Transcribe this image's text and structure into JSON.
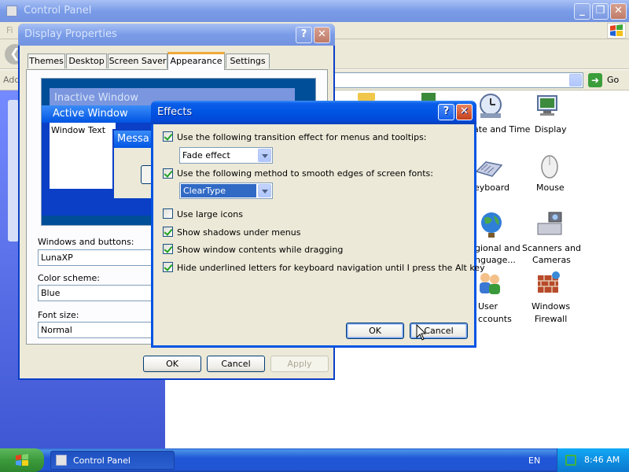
{
  "control_panel": {
    "title": "Control Panel",
    "menu_letter": "Fi",
    "address_label": "Add",
    "go_label": "Go",
    "icons": [
      {
        "label": "ate and Time",
        "icon": "clock-icon"
      },
      {
        "label": "Display",
        "icon": "display-icon"
      },
      {
        "label": "eyboard",
        "icon": "keyboard-icon"
      },
      {
        "label": "Mouse",
        "icon": "mouse-icon"
      },
      {
        "label": "gional and\nnguage...",
        "icon": "globe-icon"
      },
      {
        "label": "Scanners and\nCameras",
        "icon": "scanner-icon"
      },
      {
        "label": "User\nccounts",
        "icon": "users-icon"
      },
      {
        "label": "Windows\nFirewall",
        "icon": "firewall-icon"
      }
    ]
  },
  "display_properties": {
    "title": "Display Properties",
    "tabs": [
      "Themes",
      "Desktop",
      "Screen Saver",
      "Appearance",
      "Settings"
    ],
    "active_tab": "Appearance",
    "preview": {
      "inactive_title": "Inactive Window",
      "active_title": "Active Window",
      "window_text": "Window Text",
      "message_title": "Messa"
    },
    "windows_buttons_label": "Windows and buttons:",
    "windows_buttons_value": "LunaXP",
    "color_scheme_label": "Color scheme:",
    "color_scheme_value": "Blue",
    "font_size_label": "Font size:",
    "font_size_value": "Normal",
    "ok_label": "OK",
    "cancel_label": "Cancel",
    "apply_label": "Apply"
  },
  "effects": {
    "title": "Effects",
    "transition_label": "Use the following transition effect for menus and tooltips:",
    "transition_checked": true,
    "transition_value": "Fade effect",
    "smooth_label": "Use the following method to smooth edges of screen fonts:",
    "smooth_checked": true,
    "smooth_value": "ClearType",
    "large_icons_label": "Use large icons",
    "large_icons_checked": false,
    "shadows_label": "Show shadows under menus",
    "shadows_checked": true,
    "drag_label": "Show window contents while dragging",
    "drag_checked": true,
    "underline_label": "Hide underlined letters for keyboard navigation until I press the Alt key",
    "underline_checked": true,
    "ok_label": "OK",
    "cancel_label": "Cancel"
  },
  "taskbar": {
    "task_label": "Control Panel",
    "language": "EN",
    "time": "8:46 AM"
  },
  "colors": {
    "xp_blue": "#0054e3",
    "taskbar_blue": "#2157d7",
    "tray_blue": "#0f9df0",
    "start_green": "#3c9a3c"
  }
}
